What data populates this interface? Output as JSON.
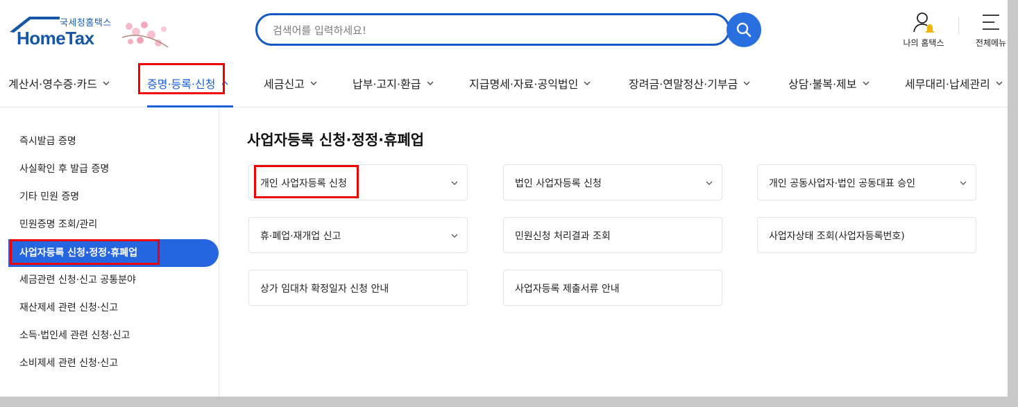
{
  "logo": {
    "small_text": "국세청홈택스",
    "brand_text": "HomeTax"
  },
  "search": {
    "placeholder": "검색어를 입력하세요!"
  },
  "utility": {
    "my_hometax": "나의 홈택스",
    "full_menu": "전체메뉴"
  },
  "nav": {
    "items": [
      {
        "label": "계산서·영수증·카드"
      },
      {
        "label": "증명·등록·신청",
        "active": true
      },
      {
        "label": "세금신고"
      },
      {
        "label": "납부·고지·환급"
      },
      {
        "label": "지급명세·자료·공익법인"
      },
      {
        "label": "장려금·연말정산·기부금"
      },
      {
        "label": "상담·불복·제보"
      },
      {
        "label": "세무대리·납세관리"
      }
    ]
  },
  "sidebar": {
    "items": [
      {
        "label": "즉시발급 증명"
      },
      {
        "label": "사실확인 후 발급 증명"
      },
      {
        "label": "기타 민원 증명"
      },
      {
        "label": "민원증명 조회/관리"
      },
      {
        "label": "사업자등록 신청·정정·휴폐업",
        "active": true
      },
      {
        "label": "세금관련 신청·신고 공통분야"
      },
      {
        "label": "재산제세 관련 신청·신고"
      },
      {
        "label": "소득·법인세 관련 신청·신고"
      },
      {
        "label": "소비제세 관련 신청·신고"
      }
    ]
  },
  "content": {
    "title": "사업자등록 신청·정정·휴폐업",
    "cards": [
      {
        "label": "개인 사업자등록 신청",
        "has_dropdown": true
      },
      {
        "label": "법인 사업자등록 신청",
        "has_dropdown": true
      },
      {
        "label": "개인 공동사업자·법인 공동대표 승인",
        "has_dropdown": true
      },
      {
        "label": "휴·폐업·재개업 신고",
        "has_dropdown": true
      },
      {
        "label": "민원신청 처리결과 조회",
        "has_dropdown": false
      },
      {
        "label": "사업자상태 조회(사업자등록번호)",
        "has_dropdown": false
      },
      {
        "label": "상가 임대차 확정일자 신청 안내",
        "has_dropdown": false
      },
      {
        "label": "사업자등록 제출서류 안내",
        "has_dropdown": false
      }
    ]
  },
  "colors": {
    "accent": "#1a5fd8",
    "highlight_box": "#e00000",
    "brand": "#1557a6"
  }
}
